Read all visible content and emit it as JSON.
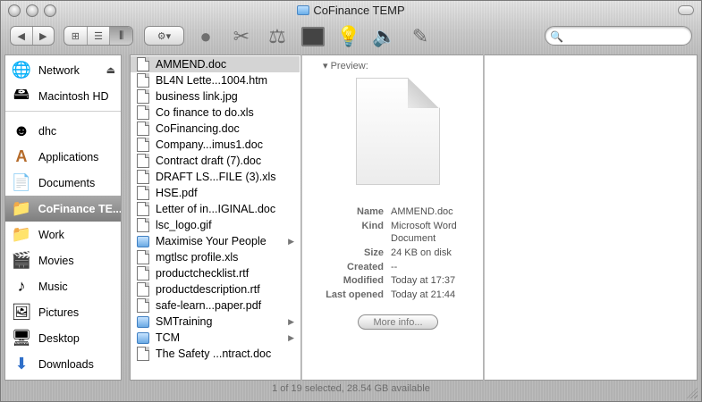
{
  "window": {
    "title": "CoFinance TEMP"
  },
  "toolbar": {
    "nav": [
      {
        "icon": "back-arrow-icon",
        "glyph": "◀"
      },
      {
        "icon": "forward-arrow-icon",
        "glyph": "▶"
      }
    ],
    "views": [
      {
        "icon": "icon-view-icon",
        "glyph": "⊞"
      },
      {
        "icon": "list-view-icon",
        "glyph": "☰"
      },
      {
        "icon": "column-view-icon",
        "glyph": "⫼",
        "selected": true
      }
    ],
    "action_glyph": "⚙▾",
    "search": {
      "placeholder": "",
      "value": ""
    }
  },
  "sidebar": {
    "items": [
      {
        "label": "Network",
        "icon": "network-globe-icon",
        "glyph": "🌐",
        "eject": true
      },
      {
        "label": "Macintosh HD",
        "icon": "hard-disk-icon",
        "glyph": "🖴"
      },
      {
        "label": "dhc",
        "icon": "user-home-icon",
        "glyph": "☻"
      },
      {
        "label": "Applications",
        "icon": "applications-icon",
        "glyph": "A"
      },
      {
        "label": "Documents",
        "icon": "documents-icon",
        "glyph": "📄"
      },
      {
        "label": "CoFinance TE...",
        "icon": "folder-icon",
        "glyph": "📁",
        "selected": true
      },
      {
        "label": "Work",
        "icon": "folder-icon",
        "glyph": "📁"
      },
      {
        "label": "Movies",
        "icon": "movies-icon",
        "glyph": "🎬"
      },
      {
        "label": "Music",
        "icon": "music-icon",
        "glyph": "♪"
      },
      {
        "label": "Pictures",
        "icon": "pictures-icon",
        "glyph": "🖼"
      },
      {
        "label": "Desktop",
        "icon": "desktop-icon",
        "glyph": "🖥"
      },
      {
        "label": "Downloads",
        "icon": "downloads-icon",
        "glyph": "⬇"
      }
    ]
  },
  "files": [
    {
      "name": "AMMEND.doc",
      "type": "doc",
      "selected": true
    },
    {
      "name": "BL4N Lette...1004.htm",
      "type": "doc"
    },
    {
      "name": "business link.jpg",
      "type": "doc"
    },
    {
      "name": "Co finance to do.xls",
      "type": "doc"
    },
    {
      "name": "CoFinancing.doc",
      "type": "doc"
    },
    {
      "name": "Company...imus1.doc",
      "type": "doc"
    },
    {
      "name": "Contract draft (7).doc",
      "type": "doc"
    },
    {
      "name": "DRAFT LS...FILE (3).xls",
      "type": "doc"
    },
    {
      "name": "HSE.pdf",
      "type": "doc"
    },
    {
      "name": "Letter of in...IGINAL.doc",
      "type": "doc"
    },
    {
      "name": "lsc_logo.gif",
      "type": "doc"
    },
    {
      "name": "Maximise Your People",
      "type": "folder"
    },
    {
      "name": "mgtlsc profile.xls",
      "type": "doc"
    },
    {
      "name": "productchecklist.rtf",
      "type": "doc"
    },
    {
      "name": "productdescription.rtf",
      "type": "doc"
    },
    {
      "name": "safe-learn...paper.pdf",
      "type": "doc"
    },
    {
      "name": "SMTraining",
      "type": "folder"
    },
    {
      "name": "TCM",
      "type": "folder"
    },
    {
      "name": "The Safety ...ntract.doc",
      "type": "doc"
    }
  ],
  "preview": {
    "heading": "Preview:",
    "rows": [
      {
        "key": "Name",
        "value": "AMMEND.doc"
      },
      {
        "key": "Kind",
        "value": "Microsoft Word"
      },
      {
        "key": "",
        "value": "Document"
      },
      {
        "key": "Size",
        "value": "24 KB on disk"
      },
      {
        "key": "Created",
        "value": "--"
      },
      {
        "key": "Modified",
        "value": "Today at 17:37"
      },
      {
        "key": "Last opened",
        "value": "Today at 21:44"
      }
    ],
    "more_info": "More info..."
  },
  "status": "1 of 19 selected, 28.54 GB available"
}
